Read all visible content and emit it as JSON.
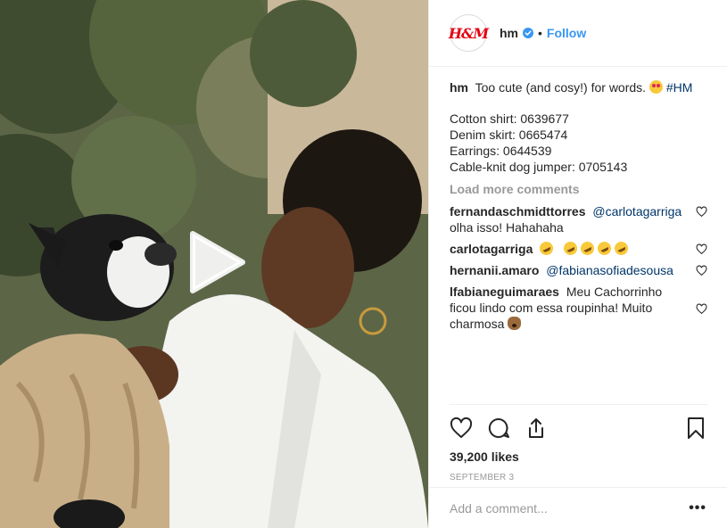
{
  "header": {
    "username": "hm",
    "avatar_logo": "H&M",
    "separator": "•",
    "follow_label": "Follow",
    "verified_icon": "verified-badge-icon"
  },
  "caption": {
    "author": "hm",
    "text": "Too cute (and cosy!) for words.",
    "hashtag": "#HM",
    "lines": [
      "Cotton shirt: 0639677",
      "Denim skirt: 0665474",
      "Earrings: 0644539",
      "Cable-knit dog jumper: 0705143"
    ]
  },
  "load_more": "Load more comments",
  "comments": [
    {
      "user": "fernandaschmidttorres",
      "mention": "@carlotagarriga",
      "text": "olha isso! Hahahaha"
    },
    {
      "user": "carlotagarriga",
      "text": ""
    },
    {
      "user": "hernanii.amaro",
      "mention": "@fabianasofiadesousa",
      "text": ""
    },
    {
      "user": "lfabianeguimaraes",
      "text": "Meu Cachorrinho ficou lindo com essa roupinha! Muito charmosa"
    }
  ],
  "actions": {
    "like_icon": "heart-icon",
    "comment_icon": "comment-icon",
    "share_icon": "share-icon",
    "save_icon": "bookmark-icon"
  },
  "likes": "39,200 likes",
  "date": "September 3",
  "comment_box": {
    "placeholder": "Add a comment...",
    "more_label": "•••"
  },
  "colors": {
    "accent": "#3897f0",
    "hashtag": "#003569",
    "brand": "#e50010"
  }
}
